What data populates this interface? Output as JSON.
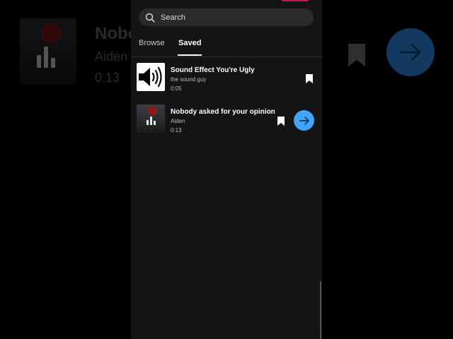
{
  "search": {
    "placeholder": "Search"
  },
  "tabs": [
    {
      "label": "Browse",
      "active": false
    },
    {
      "label": "Saved",
      "active": true
    }
  ],
  "sounds": [
    {
      "title": "Sound Effect You're Ugly",
      "artist": "the sound guy",
      "duration": "0:05",
      "thumbnail_icon": "speaker-icon",
      "bookmarked": true
    },
    {
      "title": "Nobody asked for your opinion",
      "artist": "Aiden",
      "duration": "0:13",
      "thumbnail_icon": "equalizer-icon",
      "bookmarked": true,
      "selected": true
    }
  ],
  "background": {
    "title": "Nobody",
    "artist": "Aiden",
    "duration": "0:13"
  },
  "colors": {
    "accent": "#3ea6ff",
    "panel": "#141414",
    "search_bg": "#2a2a2a"
  }
}
